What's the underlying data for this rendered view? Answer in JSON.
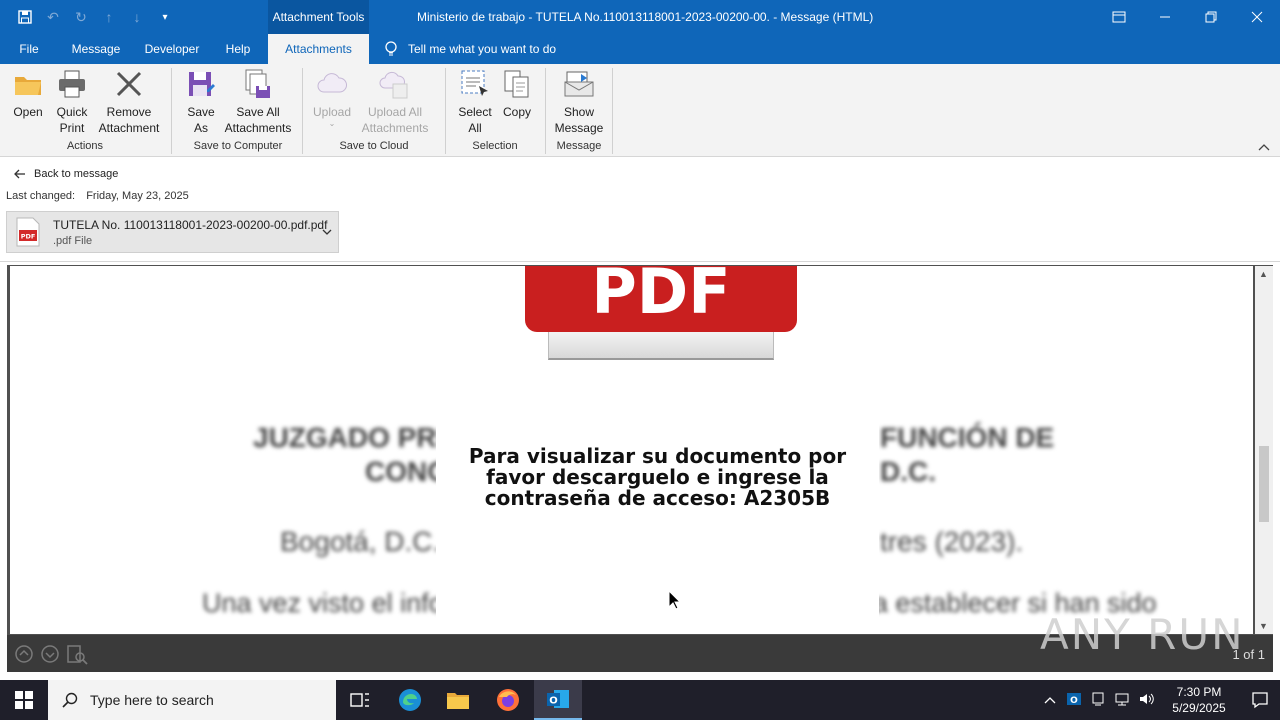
{
  "window": {
    "context_tab": "Attachment Tools",
    "title": "Ministerio de trabajo - TUTELA No.110013118001-2023-00200-00.  -  Message (HTML)"
  },
  "tabs": [
    {
      "label": "File"
    },
    {
      "label": "Message"
    },
    {
      "label": "Developer"
    },
    {
      "label": "Help"
    },
    {
      "label": "Attachments"
    }
  ],
  "tell_me": "Tell me what you want to do",
  "ribbon": {
    "open": "Open",
    "quick_print_1": "Quick",
    "quick_print_2": "Print",
    "remove_1": "Remove",
    "remove_2": "Attachment",
    "group_actions": "Actions",
    "save_as_1": "Save",
    "save_as_2": "As",
    "save_all_1": "Save All",
    "save_all_2": "Attachments",
    "group_save_computer": "Save to Computer",
    "upload": "Upload",
    "upload_all_1": "Upload All",
    "upload_all_2": "Attachments",
    "group_save_cloud": "Save to Cloud",
    "select_all_1": "Select",
    "select_all_2": "All",
    "copy": "Copy",
    "group_selection": "Selection",
    "show_message_1": "Show",
    "show_message_2": "Message",
    "group_message": "Message"
  },
  "back_to_message": "Back to message",
  "last_changed_label": "Last changed:",
  "last_changed_value": "Friday, May 23, 2025",
  "attachment": {
    "name": "TUTELA No. 110013118001-2023-00200-00.pdf.pdf",
    "type": ".pdf File"
  },
  "preview": {
    "pdf_banner": "PDF",
    "blur_line1a": "JUZGADO PRIMI",
    "blur_line1b": "FUNCIÓN DE",
    "blur_line2a": "CONO",
    "blur_line2b": "D.C.",
    "blur_line3a": "Bogotá, D.C., d",
    "blur_line3b": "tres (2023).",
    "blur_line4": "Una vez visto el informe que antecede, dispara a entrar a establecer si han sido",
    "message_line1": "Para visualizar su documento por",
    "message_line2": "favor descarguelo e ingrese la",
    "message_line3": "contraseña de acceso: A2305B",
    "page_count": "1 of 1"
  },
  "watermark": "ANY RUN",
  "taskbar": {
    "search_placeholder": "Type here to search",
    "time": "7:30 PM",
    "date": "5/29/2025"
  },
  "colors": {
    "title_blue": "#0f66b9",
    "pdf_red": "#c91f1f"
  }
}
